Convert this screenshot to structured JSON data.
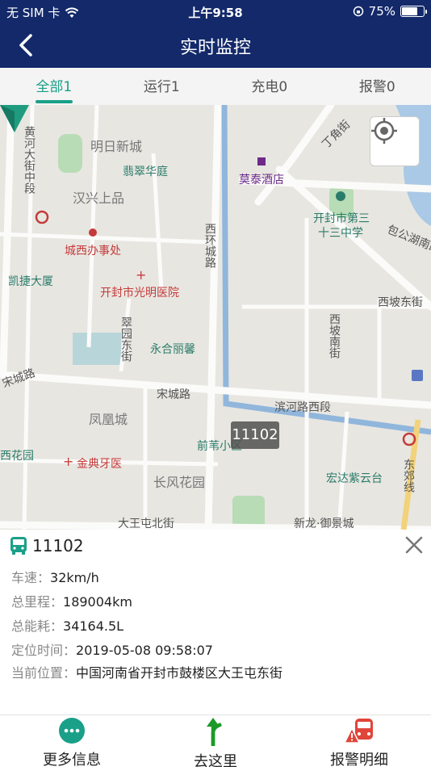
{
  "status_bar": {
    "carrier": "无 SIM 卡",
    "time": "上午9:58",
    "battery_pct": "75%",
    "battery_level": 0.75
  },
  "nav": {
    "title": "实时监控"
  },
  "tabs": [
    {
      "label": "全部1",
      "active": true
    },
    {
      "label": "运行1",
      "active": false
    },
    {
      "label": "充电0",
      "active": false
    },
    {
      "label": "报警0",
      "active": false
    }
  ],
  "map": {
    "labels": {
      "huanghe_road": "黄河大街中段",
      "ming_ri": "明日新城",
      "jiao_street": "丁角街",
      "feicui": "翡翠华庭",
      "motai": "莫泰酒店",
      "hanxing": "汉兴上品",
      "school_1": "开封市第三",
      "school_2": "十三中学",
      "baogong": "包公湖南路",
      "chengxi": "城西办事处",
      "xihuan": "西环城路",
      "kaijie": "凯捷大厦",
      "guangming": "开封市光明医院",
      "xipo_east": "西坡东街",
      "cuiyuan": "翠园东街",
      "xipo_south": "西坡南街",
      "yonghe": "永合丽馨",
      "song_road_left": "宋城路",
      "song_road": "宋城路",
      "binhe": "滨河路西段",
      "fenghuang": "凤凰城",
      "qianqu": "前苇小区",
      "xihuayuan": "西花园",
      "jindian": "金典牙医",
      "changfeng": "长风花园",
      "hongda": "宏达紫云台",
      "dongjiao": "东郊线",
      "dawang": "大王屯北街",
      "xinlong": "新龙·御景城"
    },
    "vehicle_tag": "11102"
  },
  "detail": {
    "plate": "11102",
    "rows": [
      {
        "key": "车速：",
        "value": "32km/h"
      },
      {
        "key": "总里程：",
        "value": "189004km"
      },
      {
        "key": "总能耗：",
        "value": "34164.5L"
      },
      {
        "key": "定位时间：",
        "value": "2019-05-08 09:58:07"
      },
      {
        "key": "当前位置：",
        "value": "中国河南省开封市鼓楼区大王屯东街"
      }
    ]
  },
  "bottom": {
    "more": "更多信息",
    "navigate": "去这里",
    "alarm": "报警明细"
  },
  "colors": {
    "nav_bg": "#13296a",
    "accent": "#1aa089",
    "alarm": "#e0453a"
  }
}
